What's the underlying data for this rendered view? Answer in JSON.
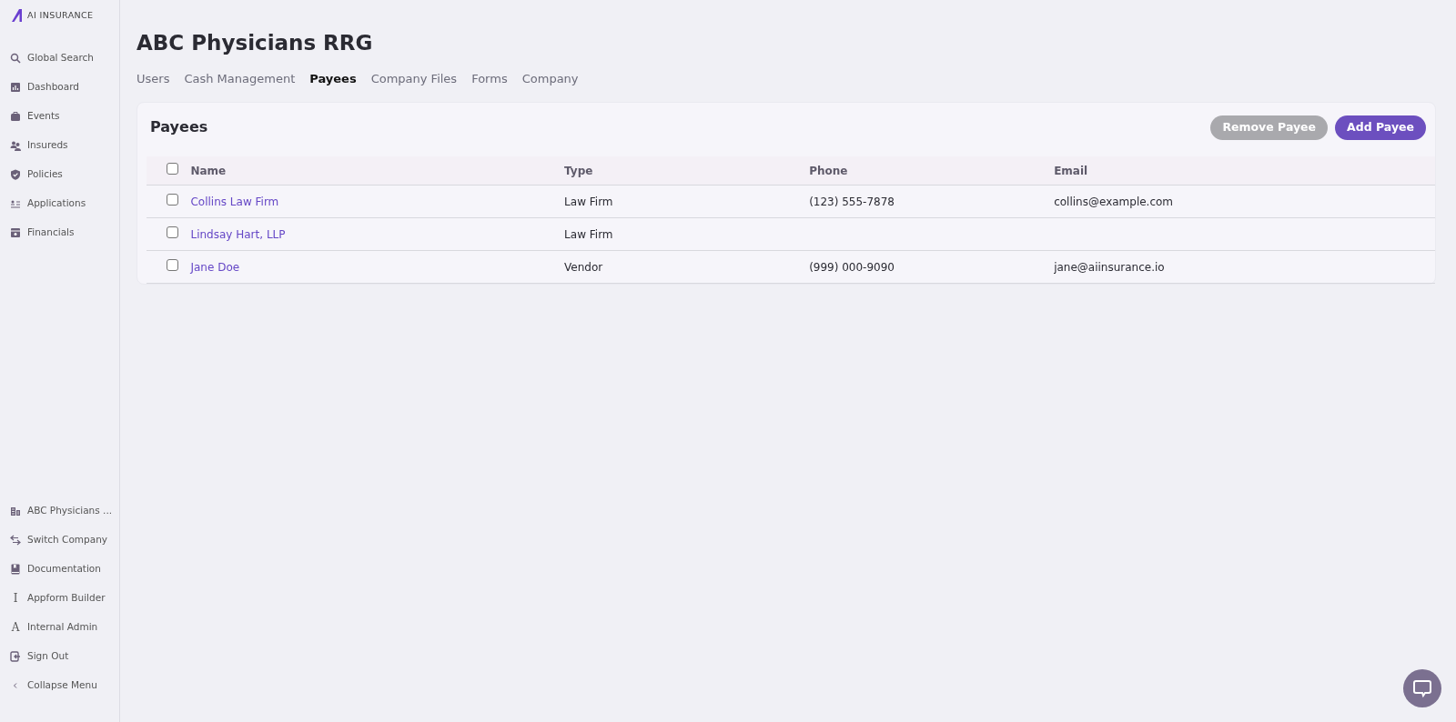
{
  "logo": {
    "text": "AI INSURANCE"
  },
  "sidebar": {
    "items": [
      {
        "label": "Global Search"
      },
      {
        "label": "Dashboard"
      },
      {
        "label": "Events"
      },
      {
        "label": "Insureds"
      },
      {
        "label": "Policies"
      },
      {
        "label": "Applications"
      },
      {
        "label": "Financials"
      }
    ],
    "bottom_items": [
      {
        "label": "ABC Physicians ..."
      },
      {
        "label": "Switch Company"
      },
      {
        "label": "Documentation"
      },
      {
        "label": "Appform Builder",
        "icon_text": "I"
      },
      {
        "label": "Internal Admin",
        "icon_text": "A"
      },
      {
        "label": "Sign Out"
      },
      {
        "label": "Collapse Menu"
      }
    ]
  },
  "page": {
    "title": "ABC Physicians RRG"
  },
  "tabs": [
    {
      "label": "Users",
      "selected": false
    },
    {
      "label": "Cash Management",
      "selected": false
    },
    {
      "label": "Payees",
      "selected": true
    },
    {
      "label": "Company Files",
      "selected": false
    },
    {
      "label": "Forms",
      "selected": false
    },
    {
      "label": "Company",
      "selected": false
    }
  ],
  "card": {
    "title": "Payees",
    "buttons": [
      {
        "label": "Remove Payee",
        "disabled": true
      },
      {
        "label": "Add Payee",
        "disabled": false
      }
    ]
  },
  "table": {
    "select_all": {
      "checked": false
    },
    "columns": [
      "Name",
      "Type",
      "Phone",
      "Email"
    ],
    "rows": [
      {
        "checked": false,
        "name": "Collins Law Firm",
        "type": "Law Firm",
        "phone": "(123) 555-7878",
        "email": "collins@example.com"
      },
      {
        "checked": false,
        "name": "Lindsay Hart, LLP",
        "type": "Law Firm"
      },
      {
        "checked": false,
        "name": "Jane Doe",
        "type": "Vendor",
        "phone": "(999) 000-9090",
        "email": "jane@aiinsurance.io"
      }
    ]
  }
}
